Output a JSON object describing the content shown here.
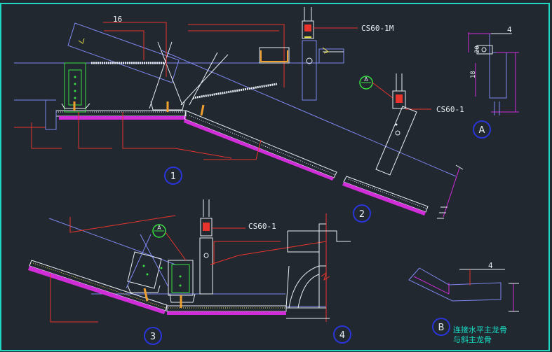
{
  "labels": {
    "dim_16": "16",
    "dim_4_top": "4",
    "dim_4_b": "4",
    "dim_20": "20",
    "dim_18": "18",
    "cs60_1m": "CS60-1M",
    "cs60_1_a": "CS60-1",
    "cs60_1_b": "CS60-1",
    "note_b_line1": "连接水平主龙骨",
    "note_b_line2": "与斜主龙骨"
  },
  "callouts": {
    "num_1": "1",
    "num_2": "2",
    "num_3": "3",
    "num_4": "4",
    "letter_a": "A",
    "letter_b": "B",
    "section_a_top": "A",
    "section_a_mid": "A"
  },
  "colors": {
    "background": "#212830",
    "frame": "#20d8c0",
    "white_line": "#e9eef2",
    "red_line": "#e8342c",
    "magenta": "#d02cd8",
    "blue_line": "#7f88f0",
    "yellow": "#e8e048",
    "orange": "#f0a030",
    "green": "#38e040"
  }
}
